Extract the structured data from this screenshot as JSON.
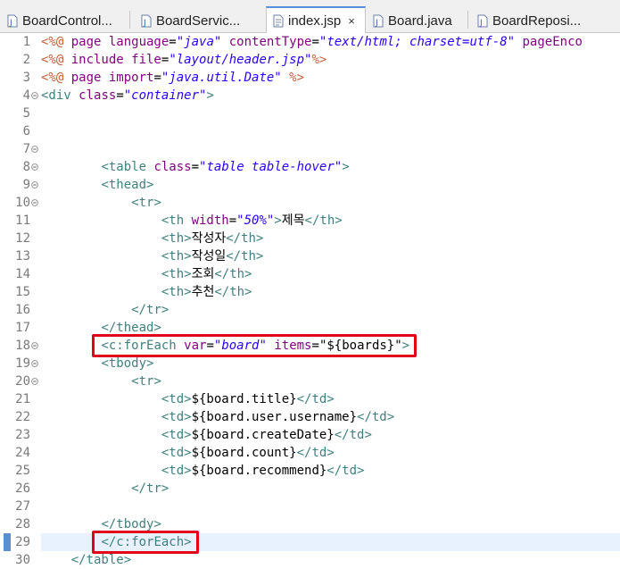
{
  "tabs": [
    {
      "label": "BoardControl...",
      "active": false
    },
    {
      "label": "BoardServic...",
      "active": false
    },
    {
      "label": "index.jsp",
      "active": true
    },
    {
      "label": "Board.java",
      "active": false
    },
    {
      "label": "BoardReposi...",
      "active": false
    }
  ],
  "close_glyph": "×",
  "lines": [
    {
      "n": "1",
      "fold": false,
      "t": [
        [
          "dir",
          "<%@ "
        ],
        [
          "attr",
          "page language"
        ],
        [
          "txt",
          "="
        ],
        [
          "val",
          "\"java\""
        ],
        [
          "txt",
          " "
        ],
        [
          "attr",
          "contentType"
        ],
        [
          "txt",
          "="
        ],
        [
          "val",
          "\"text/html; charset=utf-8\""
        ],
        [
          "txt",
          " "
        ],
        [
          "attr",
          "pageEnco"
        ]
      ]
    },
    {
      "n": "2",
      "fold": false,
      "t": [
        [
          "dir",
          "<%@ "
        ],
        [
          "attr",
          "include file"
        ],
        [
          "txt",
          "="
        ],
        [
          "val",
          "\"layout/header.jsp\""
        ],
        [
          "dir",
          "%>"
        ]
      ]
    },
    {
      "n": "3",
      "fold": false,
      "t": [
        [
          "dir",
          "<%@ "
        ],
        [
          "attr",
          "page import"
        ],
        [
          "txt",
          "="
        ],
        [
          "val",
          "\"java.util.Date\""
        ],
        [
          "txt",
          " "
        ],
        [
          "dir",
          "%>"
        ]
      ]
    },
    {
      "n": "4",
      "fold": true,
      "t": [
        [
          "tag",
          "<div "
        ],
        [
          "attr",
          "class"
        ],
        [
          "txt",
          "="
        ],
        [
          "val",
          "\"container\""
        ],
        [
          "tag",
          ">"
        ]
      ]
    },
    {
      "n": "5",
      "fold": false,
      "t": []
    },
    {
      "n": "6",
      "fold": false,
      "t": []
    },
    {
      "n": "7",
      "fold": true,
      "t": []
    },
    {
      "n": "8",
      "fold": true,
      "t": [
        [
          "txt",
          "        "
        ],
        [
          "tag",
          "<table "
        ],
        [
          "attr",
          "class"
        ],
        [
          "txt",
          "="
        ],
        [
          "val",
          "\"table table-hover\""
        ],
        [
          "tag",
          ">"
        ]
      ]
    },
    {
      "n": "9",
      "fold": true,
      "t": [
        [
          "txt",
          "        "
        ],
        [
          "tag",
          "<thead>"
        ]
      ]
    },
    {
      "n": "10",
      "fold": true,
      "t": [
        [
          "txt",
          "            "
        ],
        [
          "tag",
          "<tr>"
        ]
      ]
    },
    {
      "n": "11",
      "fold": false,
      "t": [
        [
          "txt",
          "                "
        ],
        [
          "tag",
          "<th "
        ],
        [
          "attr",
          "width"
        ],
        [
          "txt",
          "="
        ],
        [
          "val",
          "\"50%\""
        ],
        [
          "tag",
          ">"
        ],
        [
          "txt",
          "제목"
        ],
        [
          "tag",
          "</th>"
        ]
      ]
    },
    {
      "n": "12",
      "fold": false,
      "t": [
        [
          "txt",
          "                "
        ],
        [
          "tag",
          "<th>"
        ],
        [
          "txt",
          "작성자"
        ],
        [
          "tag",
          "</th>"
        ]
      ]
    },
    {
      "n": "13",
      "fold": false,
      "t": [
        [
          "txt",
          "                "
        ],
        [
          "tag",
          "<th>"
        ],
        [
          "txt",
          "작성일"
        ],
        [
          "tag",
          "</th>"
        ]
      ]
    },
    {
      "n": "14",
      "fold": false,
      "t": [
        [
          "txt",
          "                "
        ],
        [
          "tag",
          "<th>"
        ],
        [
          "txt",
          "조회"
        ],
        [
          "tag",
          "</th>"
        ]
      ]
    },
    {
      "n": "15",
      "fold": false,
      "t": [
        [
          "txt",
          "                "
        ],
        [
          "tag",
          "<th>"
        ],
        [
          "txt",
          "추천"
        ],
        [
          "tag",
          "</th>"
        ]
      ]
    },
    {
      "n": "16",
      "fold": false,
      "t": [
        [
          "txt",
          "            "
        ],
        [
          "tag",
          "</tr>"
        ]
      ]
    },
    {
      "n": "17",
      "fold": false,
      "t": [
        [
          "txt",
          "        "
        ],
        [
          "tag",
          "</thead>"
        ]
      ]
    },
    {
      "n": "18",
      "fold": true,
      "t": [
        [
          "txt",
          "        "
        ],
        [
          "tag",
          "<c:forEach "
        ],
        [
          "attr",
          "var"
        ],
        [
          "txt",
          "="
        ],
        [
          "val",
          "\"board\""
        ],
        [
          "txt",
          " "
        ],
        [
          "attr",
          "items"
        ],
        [
          "txt",
          "="
        ],
        [
          "txt",
          "\"${boards}\""
        ],
        [
          "tag",
          ">"
        ]
      ]
    },
    {
      "n": "19",
      "fold": true,
      "t": [
        [
          "txt",
          "        "
        ],
        [
          "tag",
          "<tbody>"
        ]
      ]
    },
    {
      "n": "20",
      "fold": true,
      "t": [
        [
          "txt",
          "            "
        ],
        [
          "tag",
          "<tr>"
        ]
      ]
    },
    {
      "n": "21",
      "fold": false,
      "t": [
        [
          "txt",
          "                "
        ],
        [
          "tag",
          "<td>"
        ],
        [
          "txt",
          "${board.title}"
        ],
        [
          "tag",
          "</td>"
        ]
      ]
    },
    {
      "n": "22",
      "fold": false,
      "t": [
        [
          "txt",
          "                "
        ],
        [
          "tag",
          "<td>"
        ],
        [
          "txt",
          "${board.user.username}"
        ],
        [
          "tag",
          "</td>"
        ]
      ]
    },
    {
      "n": "23",
      "fold": false,
      "t": [
        [
          "txt",
          "                "
        ],
        [
          "tag",
          "<td>"
        ],
        [
          "txt",
          "${board.createDate}"
        ],
        [
          "tag",
          "</td>"
        ]
      ]
    },
    {
      "n": "24",
      "fold": false,
      "t": [
        [
          "txt",
          "                "
        ],
        [
          "tag",
          "<td>"
        ],
        [
          "txt",
          "${board.count}"
        ],
        [
          "tag",
          "</td>"
        ]
      ]
    },
    {
      "n": "25",
      "fold": false,
      "t": [
        [
          "txt",
          "                "
        ],
        [
          "tag",
          "<td>"
        ],
        [
          "txt",
          "${board.recommend}"
        ],
        [
          "tag",
          "</td>"
        ]
      ]
    },
    {
      "n": "26",
      "fold": false,
      "t": [
        [
          "txt",
          "            "
        ],
        [
          "tag",
          "</tr>"
        ]
      ]
    },
    {
      "n": "27",
      "fold": false,
      "t": []
    },
    {
      "n": "28",
      "fold": false,
      "t": [
        [
          "txt",
          "        "
        ],
        [
          "tag",
          "</tbody>"
        ]
      ]
    },
    {
      "n": "29",
      "fold": false,
      "t": [
        [
          "txt",
          "        "
        ],
        [
          "tag",
          "</c:forEach>"
        ]
      ]
    },
    {
      "n": "30",
      "fold": false,
      "t": [
        [
          "txt",
          "    "
        ],
        [
          "tag",
          "</table>"
        ]
      ]
    }
  ],
  "current_line": "29",
  "highlighted_lines": [
    "18",
    "29"
  ],
  "colors": {
    "tag": "#3f7f7f",
    "attr": "#7f007f",
    "value": "#2a00ff",
    "directive": "#bf5f3f",
    "highlight_box": "#e2001a",
    "active_tab_accent": "#5b8dd8"
  }
}
